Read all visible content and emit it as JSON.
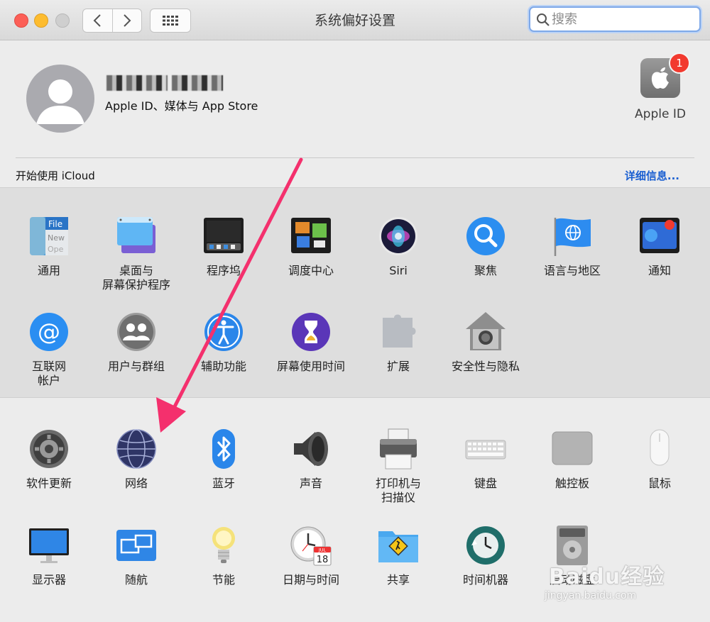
{
  "window": {
    "title": "系统偏好设置"
  },
  "search": {
    "placeholder": "搜索"
  },
  "account": {
    "subtitle": "Apple ID、媒体与 App Store",
    "apple_id_label": "Apple ID",
    "badge_count": "1"
  },
  "icloud": {
    "prompt": "开始使用 iCloud",
    "details_link": "详细信息..."
  },
  "prefs_row1": [
    {
      "label": "通用",
      "icon": "general-icon"
    },
    {
      "label": "桌面与\n屏幕保护程序",
      "icon": "desktop-screensaver-icon"
    },
    {
      "label": "程序坞",
      "icon": "dock-icon"
    },
    {
      "label": "调度中心",
      "icon": "mission-control-icon"
    },
    {
      "label": "Siri",
      "icon": "siri-icon"
    },
    {
      "label": "聚焦",
      "icon": "spotlight-icon"
    },
    {
      "label": "语言与地区",
      "icon": "language-region-icon"
    },
    {
      "label": "通知",
      "icon": "notifications-icon"
    }
  ],
  "prefs_row2": [
    {
      "label": "互联网\n帐户",
      "icon": "internet-accounts-icon"
    },
    {
      "label": "用户与群组",
      "icon": "users-groups-icon"
    },
    {
      "label": "辅助功能",
      "icon": "accessibility-icon"
    },
    {
      "label": "屏幕使用时间",
      "icon": "screen-time-icon"
    },
    {
      "label": "扩展",
      "icon": "extensions-icon"
    },
    {
      "label": "安全性与隐私",
      "icon": "security-privacy-icon"
    }
  ],
  "prefs_row3": [
    {
      "label": "软件更新",
      "icon": "software-update-icon"
    },
    {
      "label": "网络",
      "icon": "network-icon"
    },
    {
      "label": "蓝牙",
      "icon": "bluetooth-icon"
    },
    {
      "label": "声音",
      "icon": "sound-icon"
    },
    {
      "label": "打印机与\n扫描仪",
      "icon": "printers-scanners-icon"
    },
    {
      "label": "键盘",
      "icon": "keyboard-icon"
    },
    {
      "label": "触控板",
      "icon": "trackpad-icon"
    },
    {
      "label": "鼠标",
      "icon": "mouse-icon"
    }
  ],
  "prefs_row4": [
    {
      "label": "显示器",
      "icon": "displays-icon"
    },
    {
      "label": "随航",
      "icon": "sidecar-icon"
    },
    {
      "label": "节能",
      "icon": "energy-saver-icon"
    },
    {
      "label": "日期与时间",
      "icon": "date-time-icon",
      "calendar_month": "JUL",
      "calendar_day": "18"
    },
    {
      "label": "共享",
      "icon": "sharing-icon"
    },
    {
      "label": "时间机器",
      "icon": "time-machine-icon"
    },
    {
      "label": "启动磁盘",
      "icon": "startup-disk-icon"
    }
  ],
  "watermark": {
    "brand": "Baidu经验",
    "url": "jingyan.baidu.com"
  },
  "colors": {
    "annotation_arrow": "#f4306d",
    "link_blue": "#1a5fd1",
    "badge_red": "#f23a2f"
  }
}
